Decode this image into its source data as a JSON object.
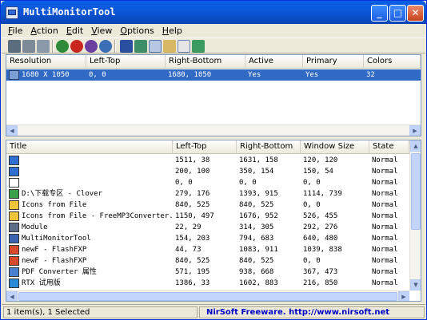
{
  "window": {
    "title": "MultiMonitorTool"
  },
  "menu": [
    "File",
    "Action",
    "Edit",
    "View",
    "Options",
    "Help"
  ],
  "monitors": {
    "columns": [
      "Resolution",
      "Left-Top",
      "Right-Bottom",
      "Active",
      "Primary",
      "Colors"
    ],
    "rows": [
      {
        "resolution": "1680 X 1050",
        "left_top": "0, 0",
        "right_bottom": "1680, 1050",
        "active": "Yes",
        "primary": "Yes",
        "colors": "32",
        "selected": true
      }
    ]
  },
  "windows": {
    "columns": [
      "Title",
      "Left-Top",
      "Right-Bottom",
      "Window Size",
      "State"
    ],
    "rows": [
      {
        "title": "",
        "left_top": "1511, 38",
        "right_bottom": "1631, 158",
        "size": "120, 120",
        "state": "Normal",
        "icon": "app-window-icon"
      },
      {
        "title": "",
        "left_top": "200, 100",
        "right_bottom": "350, 154",
        "size": "150, 54",
        "state": "Normal",
        "icon": "app-window-icon"
      },
      {
        "title": "",
        "left_top": "0, 0",
        "right_bottom": "0, 0",
        "size": "0, 0",
        "state": "Normal",
        "icon": "cursor-icon"
      },
      {
        "title": "D:\\下载专区 - Clover",
        "left_top": "279, 176",
        "right_bottom": "1393, 915",
        "size": "1114, 739",
        "state": "Normal",
        "icon": "clover-icon"
      },
      {
        "title": "Icons from File",
        "left_top": "840, 525",
        "right_bottom": "840, 525",
        "size": "0, 0",
        "state": "Normal",
        "icon": "icons-from-file-icon"
      },
      {
        "title": "Icons from File - FreeMP3Converter...",
        "left_top": "1150, 497",
        "right_bottom": "1676, 952",
        "size": "526, 455",
        "state": "Normal",
        "icon": "icons-from-file-icon"
      },
      {
        "title": "Module",
        "left_top": "22, 29",
        "right_bottom": "314, 305",
        "size": "292, 276",
        "state": "Normal",
        "icon": "module-icon"
      },
      {
        "title": "MultiMonitorTool",
        "left_top": "154, 203",
        "right_bottom": "794, 683",
        "size": "640, 480",
        "state": "Normal",
        "icon": "multimonitortool-icon"
      },
      {
        "title": "newF - FlashFXP",
        "left_top": "44, 73",
        "right_bottom": "1083, 911",
        "size": "1039, 838",
        "state": "Normal",
        "icon": "flashfxp-icon"
      },
      {
        "title": "newF - FlashFXP",
        "left_top": "840, 525",
        "right_bottom": "840, 525",
        "size": "0, 0",
        "state": "Normal",
        "icon": "flashfxp-icon"
      },
      {
        "title": "PDF Converter 属性",
        "left_top": "571, 195",
        "right_bottom": "938, 668",
        "size": "367, 473",
        "state": "Normal",
        "icon": "pdf-converter-icon"
      },
      {
        "title": "RTX 试用版",
        "left_top": "1386, 33",
        "right_bottom": "1602, 883",
        "size": "216, 850",
        "state": "Normal",
        "icon": "rtx-icon"
      }
    ]
  },
  "status": {
    "left": "1 item(s), 1 Selected",
    "right": "NirSoft Freeware.  http://www.nirsoft.net"
  },
  "colors": {
    "titlebar": "#0a5fe8",
    "selection": "#316ac5",
    "link": "#0000c8"
  }
}
